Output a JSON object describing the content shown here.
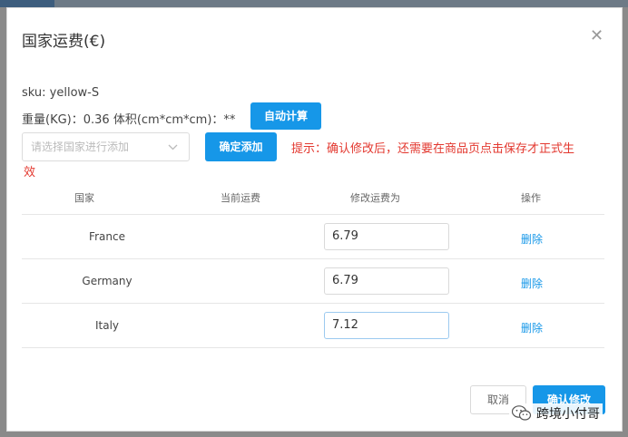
{
  "dialog": {
    "title": "国家运费(€)",
    "sku": "sku: yellow-S",
    "weight_volume": "重量(KG)：0.36 体积(cm*cm*cm)：**",
    "auto_calc_label": "自动计算",
    "country_select_placeholder": "请选择国家进行添加",
    "confirm_add_label": "确定添加",
    "tip_line1": "提示：确认修改后，还需要在商品页点击保存才正式生",
    "tip_line2": "效",
    "columns": [
      "国家",
      "当前运费",
      "修改运费为",
      "操作"
    ],
    "rows": [
      {
        "country": "France",
        "current_fee": "",
        "new_fee": "6.79",
        "action": "删除"
      },
      {
        "country": "Germany",
        "current_fee": "",
        "new_fee": "6.79",
        "action": "删除"
      },
      {
        "country": "Italy",
        "current_fee": "",
        "new_fee": "7.12",
        "action": "删除"
      }
    ],
    "cancel_label": "取消",
    "confirm_edit_label": "确认修改"
  },
  "watermark": "跨境小付哥",
  "colors": {
    "primary": "#1697e8",
    "warning_text": "#e3382f",
    "link": "#1697e8"
  }
}
